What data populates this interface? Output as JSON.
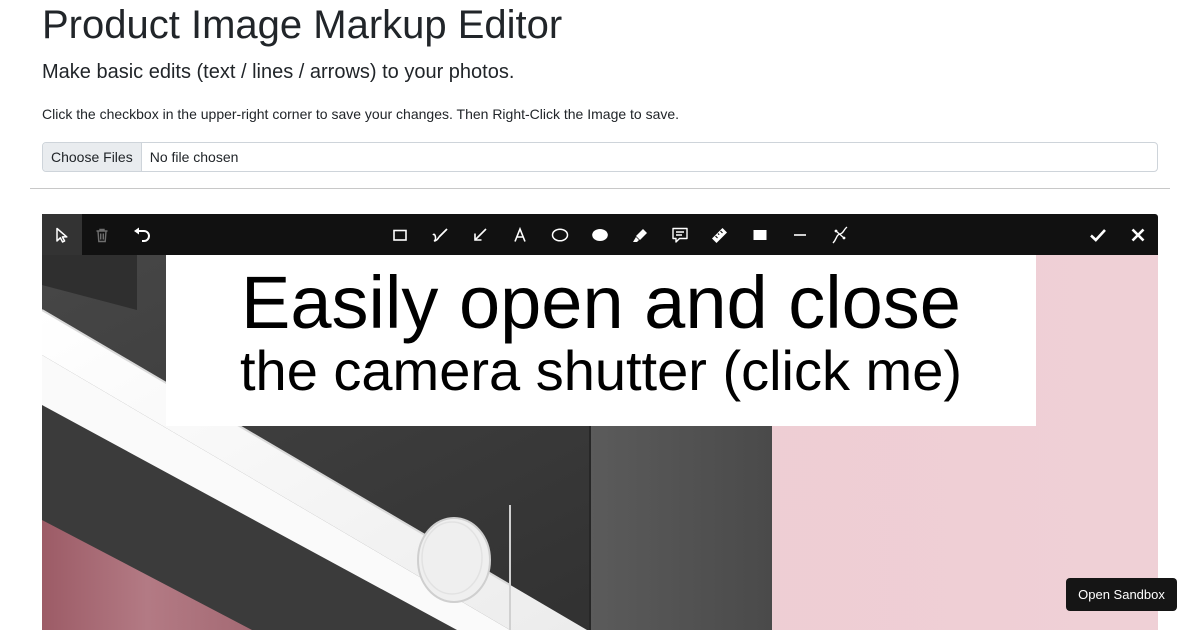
{
  "page": {
    "title": "Product Image Markup Editor",
    "subtitle": "Make basic edits (text / lines / arrows) to your photos.",
    "instructions": "Click the checkbox in the upper-right corner to save your changes. Then Right-Click the Image to save."
  },
  "file_input": {
    "button_label": "Choose Files",
    "status": "No file chosen"
  },
  "toolbar": {
    "left_tools": [
      "select-icon",
      "delete-icon",
      "undo-icon"
    ],
    "center_tools": [
      "rectangle-icon",
      "freehand-icon",
      "arrow-icon",
      "text-icon",
      "ellipse-icon",
      "filled-ellipse-icon",
      "highlighter-icon",
      "callout-icon",
      "measure-icon",
      "filled-rectangle-icon",
      "line-icon",
      "curve-icon"
    ],
    "right_tools": [
      "check-icon",
      "close-icon"
    ],
    "active_tool": "select-icon"
  },
  "canvas": {
    "caption_line1": "Easily open and close",
    "caption_line2": "the camera shutter (click me)",
    "colors": {
      "background_pink": "#eecbd2",
      "camera_dark": "#3a3a3a",
      "camera_white": "#f4f4f4",
      "lens_pink": "#a3646e"
    }
  },
  "sandbox": {
    "label": "Open Sandbox"
  }
}
